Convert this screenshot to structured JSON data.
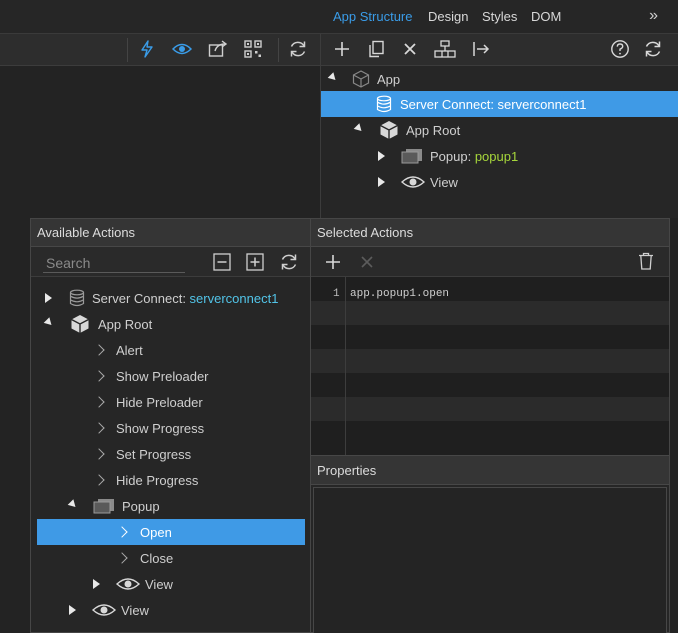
{
  "header": {
    "tabs": [
      {
        "label": "App Structure",
        "active": true
      },
      {
        "label": "Design",
        "active": false
      },
      {
        "label": "Styles",
        "active": false
      },
      {
        "label": "DOM",
        "active": false
      }
    ],
    "more": "»"
  },
  "toolbar": {
    "left_icons": [
      "lightning-icon",
      "eye-icon",
      "share-icon",
      "qr-code-icon",
      "refresh-icon"
    ],
    "right_icons": [
      "add-icon",
      "copy-icon",
      "delete-icon",
      "hierarchy-icon",
      "export-icon",
      "help-icon",
      "refresh-icon"
    ]
  },
  "app_structure": {
    "items": [
      {
        "label": "App",
        "icon": "cube-outline-icon",
        "expanded": true
      },
      {
        "label": "Server Connect: ",
        "value": "serverconnect1",
        "icon": "database-icon",
        "selected": true
      },
      {
        "label": "App Root",
        "icon": "cube-icon",
        "expanded": true
      },
      {
        "label": "Popup: ",
        "value": "popup1",
        "icon": "popup-icon",
        "expanded": false
      },
      {
        "label": "View",
        "icon": "eye-icon",
        "expanded": false
      }
    ]
  },
  "available_actions": {
    "title": "Available Actions",
    "search_placeholder": "Search",
    "items": [
      {
        "label": "Server Connect: ",
        "value": "serverconnect1"
      },
      {
        "label": "App Root"
      },
      {
        "label": "Alert"
      },
      {
        "label": "Show Preloader"
      },
      {
        "label": "Hide Preloader"
      },
      {
        "label": "Show Progress"
      },
      {
        "label": "Set Progress"
      },
      {
        "label": "Hide Progress"
      },
      {
        "label": "Popup"
      },
      {
        "label": "Open",
        "selected": true
      },
      {
        "label": "Close"
      },
      {
        "label": "View"
      },
      {
        "label": "View"
      }
    ]
  },
  "selected_actions": {
    "title": "Selected Actions",
    "lines": [
      {
        "number": "1",
        "code": "app.popup1.open"
      }
    ]
  },
  "properties": {
    "title": "Properties"
  },
  "colors": {
    "accent": "#3f9ae6",
    "active_tab": "#3a9ce8",
    "popup_value": "#a6d63b",
    "server_value": "#52c4e8"
  }
}
